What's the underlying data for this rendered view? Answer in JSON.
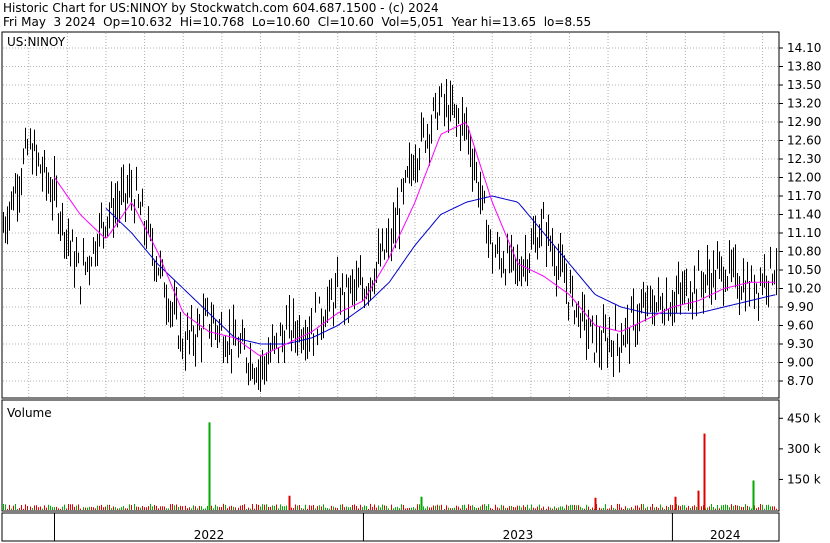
{
  "header": {
    "line1": "Historic Chart for US:NINOY by Stockwatch.com 604.687.1500 - (c) 2024",
    "line2": "Fri May  3 2024  Op=10.632  Hi=10.768  Lo=10.60  Cl=10.60  Vol=5,051  Year hi=13.65  lo=8.55"
  },
  "colors": {
    "price_bar": "#000000",
    "ma_short": "#ff00ff",
    "ma_long": "#0000cc",
    "volume_up": "#00aa00",
    "volume_down": "#dd0000",
    "grid": "#b0b0b0"
  },
  "chart_data": [
    {
      "type": "line",
      "title": "US:NINOY",
      "y_ticks": [
        "14.10",
        "13.80",
        "13.50",
        "13.20",
        "12.90",
        "12.60",
        "12.30",
        "12.00",
        "11.70",
        "11.40",
        "11.10",
        "10.80",
        "10.50",
        "10.20",
        "9.90",
        "9.60",
        "9.30",
        "9.00",
        "8.70"
      ],
      "ylim": [
        8.5,
        14.3
      ],
      "x_labels": [
        "2022",
        "2023",
        "2024"
      ],
      "x_range": [
        "2021-11",
        "2024-05"
      ],
      "grid": true,
      "series": [
        {
          "kind": "price-bars",
          "x": [
            "2021-11",
            "2021-12",
            "2022-01",
            "2022-02",
            "2022-03",
            "2022-04",
            "2022-05",
            "2022-06",
            "2022-07",
            "2022-08",
            "2022-09",
            "2022-10",
            "2022-11",
            "2022-12",
            "2023-01",
            "2023-02",
            "2023-03",
            "2023-04",
            "2023-05",
            "2023-06",
            "2023-07",
            "2023-08",
            "2023-09",
            "2023-10",
            "2023-11",
            "2023-12",
            "2024-01",
            "2024-02",
            "2024-03",
            "2024-04",
            "2024-05"
          ],
          "values": [
            11.2,
            12.5,
            11.7,
            10.4,
            11.4,
            11.8,
            10.6,
            9.3,
            9.7,
            9.3,
            8.9,
            9.5,
            9.6,
            10.1,
            10.2,
            10.9,
            12.4,
            13.2,
            12.8,
            10.8,
            10.5,
            11.2,
            10.1,
            9.3,
            9.4,
            9.9,
            10.0,
            10.3,
            10.5,
            10.2,
            10.6
          ]
        },
        {
          "kind": "moving-average-short",
          "x": [
            "2021-11",
            "2021-12",
            "2022-01",
            "2022-02",
            "2022-03",
            "2022-04",
            "2022-05",
            "2022-06",
            "2022-07",
            "2022-08",
            "2022-09",
            "2022-10",
            "2022-11",
            "2022-12",
            "2023-01",
            "2023-02",
            "2023-03",
            "2023-04",
            "2023-05",
            "2023-06",
            "2023-07",
            "2023-08",
            "2023-09",
            "2023-10",
            "2023-11",
            "2023-12",
            "2024-01",
            "2024-02",
            "2024-03",
            "2024-04",
            "2024-05"
          ],
          "values": [
            null,
            null,
            12.0,
            11.4,
            11.0,
            11.6,
            10.8,
            9.8,
            9.5,
            9.4,
            9.1,
            9.3,
            9.5,
            9.8,
            10.0,
            10.7,
            11.6,
            12.7,
            12.9,
            11.6,
            10.6,
            10.4,
            10.1,
            9.6,
            9.5,
            9.7,
            9.9,
            10.0,
            10.2,
            10.3,
            10.3
          ]
        },
        {
          "kind": "moving-average-long",
          "x": [
            "2021-11",
            "2021-12",
            "2022-01",
            "2022-02",
            "2022-03",
            "2022-04",
            "2022-05",
            "2022-06",
            "2022-07",
            "2022-08",
            "2022-09",
            "2022-10",
            "2022-11",
            "2022-12",
            "2023-01",
            "2023-02",
            "2023-03",
            "2023-04",
            "2023-05",
            "2023-06",
            "2023-07",
            "2023-08",
            "2023-09",
            "2023-10",
            "2023-11",
            "2023-12",
            "2024-01",
            "2024-02",
            "2024-03",
            "2024-04",
            "2024-05"
          ],
          "values": [
            null,
            null,
            null,
            null,
            11.5,
            11.1,
            10.6,
            10.2,
            9.8,
            9.4,
            9.3,
            9.3,
            9.4,
            9.6,
            9.9,
            10.3,
            10.9,
            11.4,
            11.6,
            11.7,
            11.6,
            11.1,
            10.6,
            10.1,
            9.9,
            9.8,
            9.8,
            9.8,
            9.9,
            10.0,
            10.1
          ]
        }
      ]
    },
    {
      "type": "bar",
      "title": "Volume",
      "y_ticks": [
        "450 k",
        "300 k",
        "150 k"
      ],
      "ylim": [
        0,
        530
      ],
      "unit": "k",
      "x_labels": [
        "2022",
        "2023",
        "2024"
      ],
      "spikes": [
        {
          "date": "2022-07",
          "value": 430,
          "color": "green"
        },
        {
          "date": "2022-10",
          "value": 70,
          "color": "red"
        },
        {
          "date": "2023-03",
          "value": 65,
          "color": "green"
        },
        {
          "date": "2023-10",
          "value": 60,
          "color": "red"
        },
        {
          "date": "2024-01",
          "value": 65,
          "color": "red"
        },
        {
          "date": "2024-02",
          "value": 375,
          "color": "red"
        },
        {
          "date": "2024-02",
          "value": 95,
          "color": "red"
        },
        {
          "date": "2024-04",
          "value": 145,
          "color": "green"
        }
      ],
      "baseline_range": [
        5,
        30
      ]
    }
  ]
}
